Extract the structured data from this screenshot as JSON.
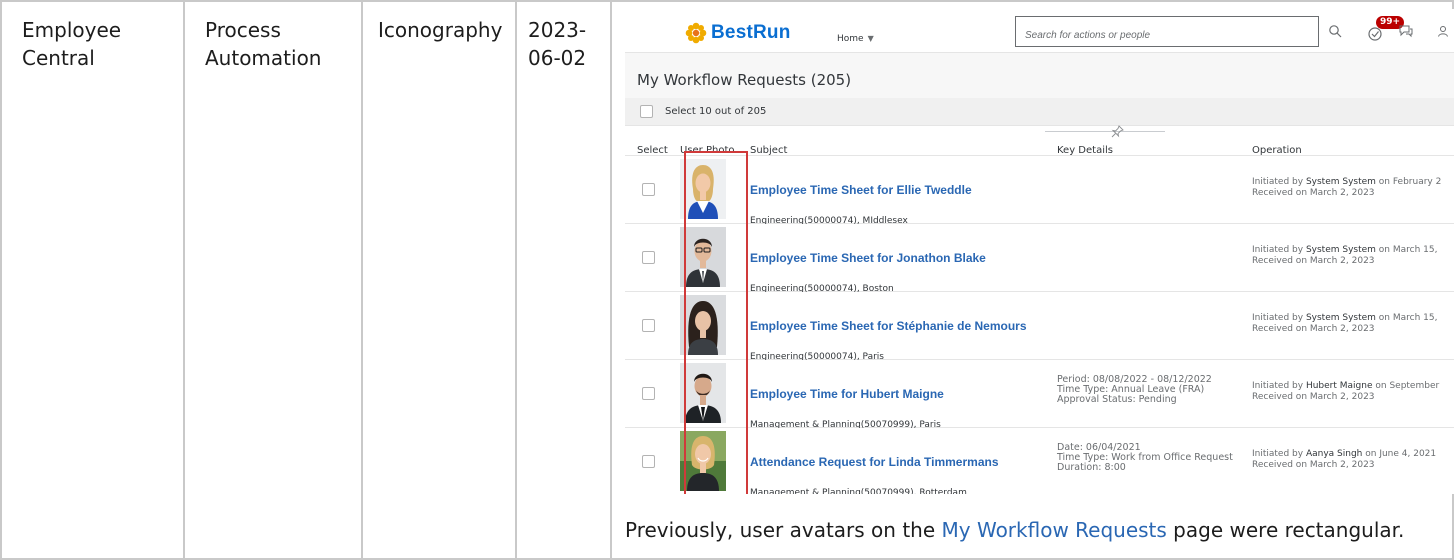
{
  "table": {
    "col1": [
      "Employee",
      "Central"
    ],
    "col2": [
      "Process",
      "Automation"
    ],
    "col3": "Iconography",
    "col4": [
      "2023-",
      "06-02"
    ]
  },
  "screenshot": {
    "brand": "BestRun",
    "home_menu": "Home",
    "search_placeholder": "Search for actions or people",
    "notification_badge": "99+",
    "page_title": "My Workflow Requests (205)",
    "select_label": "Select 10 out of 205",
    "columns": {
      "select": "Select",
      "photo": "User Photo",
      "subject": "Subject",
      "key_details": "Key Details",
      "operation": "Operation"
    },
    "rows": [
      {
        "title": "Employee Time Sheet for Ellie Tweddle",
        "sub": "Engineering(50000074), MIddlesex",
        "details": [],
        "initiated_by": "System System",
        "initiated_on": "February 2",
        "received": "Received on March 2, 2023",
        "photo": "woman-blonde"
      },
      {
        "title": "Employee Time Sheet for Jonathon Blake",
        "sub": "Engineering(50000074), Boston",
        "details": [],
        "initiated_by": "System System",
        "initiated_on": "March 15,",
        "received": "Received on March 2, 2023",
        "photo": "man-glasses"
      },
      {
        "title": "Employee Time Sheet for Stéphanie de Nemours",
        "sub": "Engineering(50000074), Paris",
        "details": [],
        "initiated_by": "System System",
        "initiated_on": "March 15,",
        "received": "Received on March 2, 2023",
        "photo": "woman-brunette"
      },
      {
        "title": "Employee Time for Hubert Maigne",
        "sub": "Management & Planning(50070999), Paris",
        "details": [
          "Period: 08/08/2022 - 08/12/2022",
          "Time Type: Annual Leave (FRA)",
          "Approval Status: Pending"
        ],
        "initiated_by": "Hubert Maigne",
        "initiated_on": "September",
        "received": "Received on March 2, 2023",
        "photo": "man-suit"
      },
      {
        "title": "Attendance Request for Linda Timmermans",
        "sub": "Management & Planning(50070999), Rotterdam",
        "details": [
          "Date: 06/04/2021",
          "Time Type: Work from Office Request",
          "Duration: 8:00"
        ],
        "initiated_by": "Aanya Singh",
        "initiated_on": "June 4, 2021",
        "received": "Received on March 2, 2023",
        "photo": "woman-smiling"
      }
    ]
  },
  "caption": {
    "before": "Previously, user avatars on the ",
    "link": "My Workflow Requests",
    "after": " page were rectangular."
  },
  "colors": {
    "brand_blue": "#0a6ed1",
    "link_blue": "#2a67b3",
    "highlight_red": "#d03a3a",
    "badge_red": "#bb0000"
  }
}
